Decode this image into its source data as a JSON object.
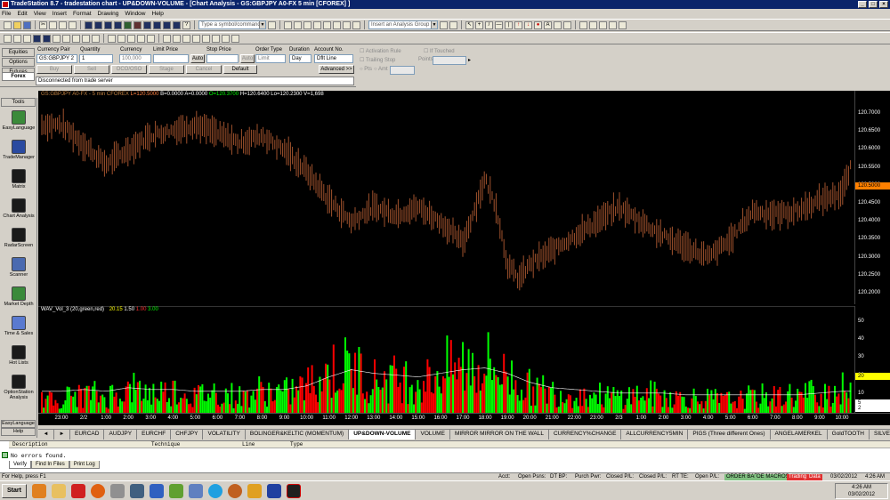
{
  "window": {
    "title": "TradeStation 8.7 - tradestation chart - UP&DOWN-VOLUME - [Chart Analysis - GS:GBPJPY A0-FX 5 min [CFOREX] ]"
  },
  "menu": [
    "File",
    "Edit",
    "View",
    "Insert",
    "Format",
    "Drawing",
    "Window",
    "Help"
  ],
  "toolbar": {
    "symbol_placeholder": "Type a symbol/command",
    "analysis_group_placeholder": "Insert an Analysis Group"
  },
  "trade_bar": {
    "tabs": [
      "Equities",
      "Options",
      "Futures",
      "Forex"
    ],
    "active_tab": "Forex",
    "labels": {
      "currency_pair": "Currency Pair",
      "quantity": "Quantity",
      "currency": "Currency",
      "limit_price": "Limit Price",
      "stop_price": "Stop Price",
      "order_type": "Order Type",
      "duration": "Duration",
      "account_no": "Account No."
    },
    "values": {
      "currency_pair": "GS:GBPJPY 2",
      "quantity": "1",
      "currency": "100,000",
      "limit_price": "Auto",
      "stop_price": "Auto",
      "order_type": "Limit",
      "duration": "Day",
      "account_no": "Dflt Line"
    },
    "buttons": {
      "buy": "Buy",
      "sell": "Sell",
      "oco": "OCO/OSO",
      "stage": "Stage",
      "cancel": "Cancel",
      "default": "Default",
      "advanced": "Advanced >>"
    },
    "options": {
      "activation_rule": "Activation Rule",
      "if_touched": "If Touched",
      "trailing_stop": "Trailing Stop",
      "points": "Points",
      "pts": "Pts",
      "amt": "Amt"
    },
    "status": "Disconnected from trade server"
  },
  "sidebar": {
    "header": "Tools",
    "items": [
      {
        "label": "EasyLanguage",
        "color": "#3a8a3a"
      },
      {
        "label": "TradeManager",
        "color": "#2a4aa0"
      },
      {
        "label": "Matrix",
        "color": "#1a1a1a"
      },
      {
        "label": "Chart Analysis",
        "color": "#1a1a1a"
      },
      {
        "label": "RadarScreen",
        "color": "#1a1a1a"
      },
      {
        "label": "Scanner",
        "color": "#4a6ab0"
      },
      {
        "label": "Market Depth",
        "color": "#3a8a3a"
      },
      {
        "label": "Time & Sales",
        "color": "#5a7ad0"
      },
      {
        "label": "Hot Lists",
        "color": "#1a1a1a"
      },
      {
        "label": "OptionStation Analysis",
        "color": "#1a1a1a"
      }
    ],
    "footer": [
      "EasyLanguage",
      "Help"
    ]
  },
  "chart": {
    "symbol_name": "GS:GBPJPY A0-FX - 5 min  CFOREX",
    "last": "L=120.5000",
    "bid": "B=0.0000",
    "ask": "A=0.0000",
    "open": "O=120.3700",
    "high": "H=120.6400",
    "low": "Lo=120.2300",
    "volume": "V=1,698",
    "indicator_name": "WAV_Vol_3 (20,green,red)",
    "indicator_vals": [
      "20.15",
      "1.50",
      "1.00",
      "3.00"
    ],
    "price_tag": "120.5000",
    "vol_tag_1": "20",
    "vol_tag_2": "5",
    "vol_tag_3": "2",
    "colors": {
      "price_bar": "#a0522d",
      "up_volume": "#00ff00",
      "down_volume": "#ff0000",
      "avg_line": "#ffffff",
      "price_tag": "#ff8000"
    }
  },
  "chart_data": {
    "type": "bar",
    "title": "",
    "price_axis_ticks": [
      "120.7000",
      "120.6500",
      "120.6000",
      "120.5500",
      "120.5000",
      "120.4500",
      "120.4000",
      "120.3500",
      "120.3000",
      "120.2500",
      "120.2000"
    ],
    "price_range": [
      120.18,
      120.73
    ],
    "volume_axis_ticks": [
      "50",
      "40",
      "30",
      "20",
      "10"
    ],
    "volume_range": [
      0,
      55
    ],
    "time_ticks": [
      "23:00",
      "2/2",
      "1:00",
      "2:00",
      "3:00",
      "4:00",
      "5:00",
      "6:00",
      "7:00",
      "8:00",
      "9:00",
      "10:00",
      "11:00",
      "12:00",
      "13:00",
      "14:00",
      "15:00",
      "16:00",
      "17:00",
      "18:00",
      "19:00",
      "20:00",
      "21:00",
      "22:00",
      "23:00",
      "2/3",
      "1:00",
      "2:00",
      "3:00",
      "4:00",
      "5:00",
      "6:00",
      "7:00",
      "8:00",
      "9:00",
      "10:00"
    ],
    "price_path": [
      [
        0,
        120.67
      ],
      [
        2,
        120.56
      ],
      [
        4,
        120.64
      ],
      [
        6,
        120.67
      ],
      [
        8,
        120.62
      ],
      [
        9,
        120.64
      ],
      [
        10,
        120.6
      ],
      [
        11,
        120.54
      ],
      [
        12,
        120.46
      ],
      [
        13,
        120.4
      ],
      [
        14,
        120.44
      ],
      [
        15,
        120.42
      ],
      [
        16,
        120.44
      ],
      [
        17,
        120.4
      ],
      [
        18,
        120.34
      ],
      [
        19,
        120.52
      ],
      [
        19.5,
        120.44
      ],
      [
        20,
        120.28
      ],
      [
        20.5,
        120.24
      ],
      [
        21,
        120.28
      ],
      [
        22,
        120.32
      ],
      [
        23,
        120.36
      ],
      [
        24,
        120.4
      ],
      [
        25,
        120.44
      ],
      [
        26,
        120.4
      ],
      [
        27,
        120.36
      ],
      [
        28,
        120.33
      ],
      [
        29,
        120.3
      ],
      [
        30,
        120.35
      ],
      [
        31,
        120.43
      ],
      [
        32,
        120.42
      ],
      [
        33,
        120.43
      ],
      [
        34,
        120.46
      ],
      [
        35,
        120.48
      ],
      [
        35.5,
        120.57
      ],
      [
        36,
        120.52
      ],
      [
        36.5,
        120.5
      ]
    ],
    "series": [
      {
        "name": "up_volume",
        "values": [
          8,
          12,
          9,
          15,
          11,
          14,
          10,
          12,
          9,
          13,
          11,
          16,
          22,
          26,
          20,
          21,
          18,
          24,
          27,
          28,
          22,
          14,
          12,
          11,
          10,
          9,
          11,
          10,
          9,
          8,
          8,
          9,
          10,
          10,
          12,
          13
        ]
      },
      {
        "name": "down_volume",
        "values": [
          7,
          10,
          8,
          12,
          10,
          12,
          9,
          11,
          8,
          12,
          10,
          15,
          24,
          25,
          18,
          19,
          16,
          22,
          25,
          26,
          20,
          13,
          11,
          10,
          9,
          8,
          10,
          9,
          8,
          7,
          7,
          8,
          9,
          9,
          11,
          12
        ]
      },
      {
        "name": "average",
        "values": [
          12,
          13,
          12,
          14,
          13,
          13,
          12,
          12,
          12,
          13,
          13,
          15,
          20,
          24,
          22,
          21,
          20,
          22,
          24,
          25,
          22,
          17,
          14,
          13,
          12,
          11,
          11,
          11,
          10,
          10,
          10,
          10,
          10,
          10,
          11,
          12
        ]
      }
    ]
  },
  "workspace_tabs": {
    "nav": [
      "◄",
      "►"
    ],
    "items": [
      "EURCAD",
      "AUDJPY",
      "EURCHF",
      "CHFJPY",
      "VOLATILITY",
      "BOLINGER&KELTIC (MOMENTUM)",
      "UP&DOWN-VOLUME",
      "VOLUME",
      "MIRROR MIRROR ON THE WALL",
      "CURRENCY%CHANGE",
      "ALLCURRENCY5MIN",
      "PIGS (Three different Ones)",
      "ANGELAMERKEL",
      "GoldTOOTH",
      "SILVERSICKLE"
    ],
    "active": "UP&DOWN-VOLUME"
  },
  "output": {
    "columns": [
      "Description",
      "Technique",
      "Line",
      "Type"
    ],
    "message": "No errors found.",
    "tabs": [
      "Verify",
      "Find In Files",
      "Print Log"
    ],
    "active_tab": "Verify"
  },
  "status_bar": {
    "help_text": "For Help, press F1",
    "cells": [
      "Acct:",
      "Open Psns:",
      "DT BP:",
      "Purch Pwr:",
      "Closed P/L:",
      "Closed P/L:",
      "RT TE:",
      "Open P/L:"
    ],
    "flags": [
      "ORDER BAR",
      "OE MACROS",
      "Trading",
      "Data"
    ],
    "date": "03/02/2012",
    "time": "4:26 AM"
  },
  "taskbar": {
    "start_label": "Start",
    "tray_time": "4:26 AM",
    "tray_date": "03/02/2012"
  }
}
